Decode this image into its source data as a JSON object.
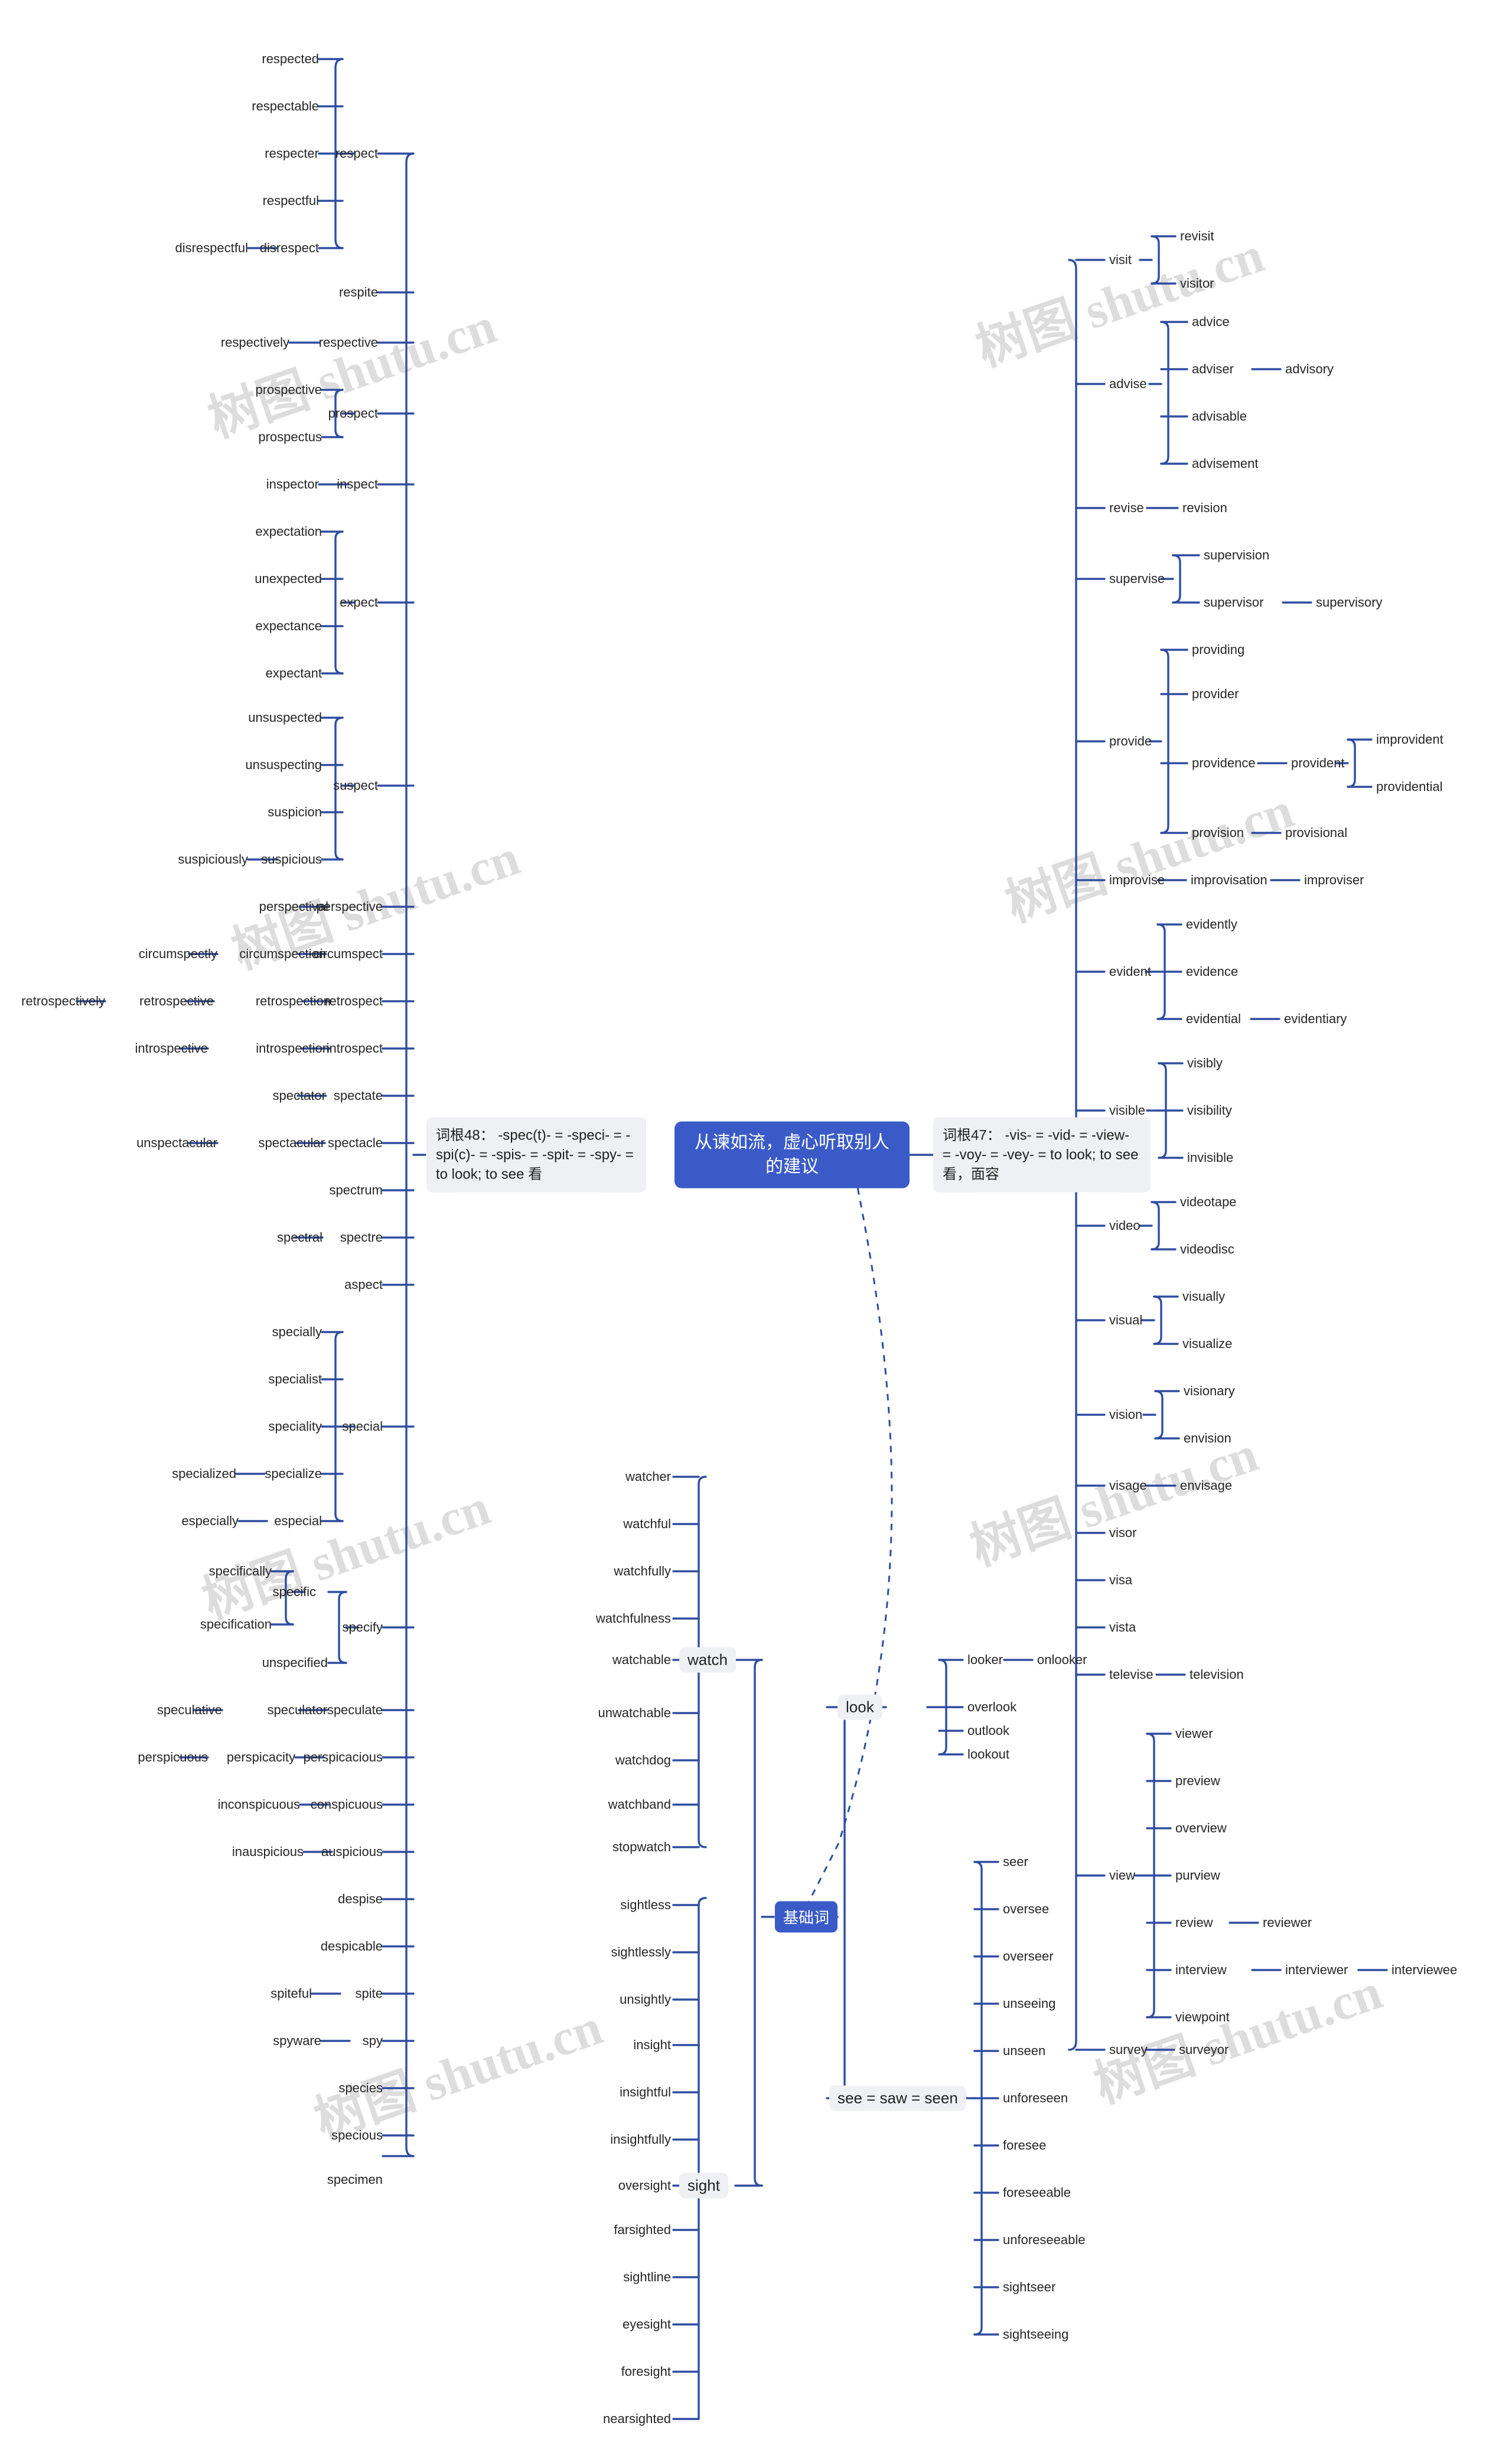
{
  "meta": {
    "root_left_label": "词根48： -spec(t)- = -speci- = -spi(c)- = -spis- = -spit- = -spy- = to look; to see 看",
    "root_center_label": "从谏如流，虚心听取别人的建议",
    "root_right_label": "词根47： -vis- = -vid- = -view- = -voy- = -vey- = to look; to see 看，面容",
    "basic_word_label": "基础词",
    "watermark_text": "树图 shutu.cn",
    "accent_color": "#3a5bc7",
    "link_color": "#2f4da0",
    "chip_bg": "#eef0f4",
    "text_color": "#262626"
  },
  "left_branch": {
    "title": "词根48： -spec(t)- = -speci- = -spi(c)- = -spis- = -spit- = -spy- = to look; to see 看",
    "children": [
      {
        "label": "respect",
        "children": [
          {
            "label": "respected"
          },
          {
            "label": "respectable"
          },
          {
            "label": "respecter"
          },
          {
            "label": "respectful"
          },
          {
            "label": "disrespect",
            "children": [
              {
                "label": "disrespectful"
              }
            ]
          }
        ]
      },
      {
        "label": "respite"
      },
      {
        "label": "respective",
        "children": [
          {
            "label": "respectively"
          }
        ]
      },
      {
        "label": "prospect",
        "children": [
          {
            "label": "prospective"
          },
          {
            "label": "prospectus"
          }
        ]
      },
      {
        "label": "inspect",
        "children": [
          {
            "label": "inspector"
          }
        ]
      },
      {
        "label": "expect",
        "children": [
          {
            "label": "expectation"
          },
          {
            "label": "unexpected"
          },
          {
            "label": "expectance"
          },
          {
            "label": "expectant"
          }
        ]
      },
      {
        "label": "suspect",
        "children": [
          {
            "label": "unsuspected"
          },
          {
            "label": "unsuspecting"
          },
          {
            "label": "suspicion"
          },
          {
            "label": "suspicious",
            "children": [
              {
                "label": "suspiciously"
              }
            ]
          }
        ]
      },
      {
        "label": "perspective",
        "children": [
          {
            "label": "perspectival"
          }
        ]
      },
      {
        "label": "circumspect",
        "children": [
          {
            "label": "circumspection",
            "children": [
              {
                "label": "circumspectly"
              }
            ]
          }
        ]
      },
      {
        "label": "retrospect",
        "children": [
          {
            "label": "retrospection",
            "children": [
              {
                "label": "retrospective",
                "children": [
                  {
                    "label": "retrospectively"
                  }
                ]
              }
            ]
          }
        ]
      },
      {
        "label": "introspect",
        "children": [
          {
            "label": "introspection",
            "children": [
              {
                "label": "introspective"
              }
            ]
          }
        ]
      },
      {
        "label": "spectate",
        "children": [
          {
            "label": "spectator"
          }
        ]
      },
      {
        "label": "spectacle",
        "children": [
          {
            "label": "spectacular",
            "children": [
              {
                "label": "unspectacular"
              }
            ]
          }
        ]
      },
      {
        "label": "spectrum"
      },
      {
        "label": "spectre",
        "children": [
          {
            "label": "spectral"
          }
        ]
      },
      {
        "label": "aspect"
      },
      {
        "label": "special",
        "children": [
          {
            "label": "specially"
          },
          {
            "label": "specialist"
          },
          {
            "label": "speciality"
          },
          {
            "label": "specialize",
            "children": [
              {
                "label": "specialized"
              }
            ]
          },
          {
            "label": "especial",
            "children": [
              {
                "label": "especially"
              }
            ]
          }
        ]
      },
      {
        "label": "specify",
        "children": [
          {
            "label": "specific",
            "children": [
              {
                "label": "specifically"
              },
              {
                "label": "specification"
              }
            ]
          },
          {
            "label": "unspecified"
          }
        ]
      },
      {
        "label": "speculate",
        "children": [
          {
            "label": "speculator",
            "children": [
              {
                "label": "speculative"
              }
            ]
          }
        ]
      },
      {
        "label": "perspicacious",
        "children": [
          {
            "label": "perspicacity",
            "children": [
              {
                "label": "perspicuous"
              }
            ]
          }
        ]
      },
      {
        "label": "conspicuous",
        "children": [
          {
            "label": "inconspicuous"
          }
        ]
      },
      {
        "label": "auspicious",
        "children": [
          {
            "label": "inauspicious"
          }
        ]
      },
      {
        "label": "despise"
      },
      {
        "label": "despicable"
      },
      {
        "label": "spite",
        "children": [
          {
            "label": "spiteful"
          }
        ]
      },
      {
        "label": "spy",
        "children": [
          {
            "label": "spyware"
          }
        ]
      },
      {
        "label": "species"
      },
      {
        "label": "specious"
      },
      {
        "label": "specimen"
      }
    ]
  },
  "right_branch": {
    "title": "词根47： -vis- = -vid- = -view- = -voy- = -vey- = to look; to see 看，面容",
    "children": [
      {
        "label": "visit",
        "children": [
          {
            "label": "revisit"
          },
          {
            "label": "visitor"
          }
        ]
      },
      {
        "label": "advise",
        "children": [
          {
            "label": "advice"
          },
          {
            "label": "adviser",
            "children": [
              {
                "label": "advisory"
              }
            ]
          },
          {
            "label": "advisable"
          },
          {
            "label": "advisement"
          }
        ]
      },
      {
        "label": "revise",
        "children": [
          {
            "label": "revision"
          }
        ]
      },
      {
        "label": "supervise",
        "children": [
          {
            "label": "supervision"
          },
          {
            "label": "supervisor",
            "children": [
              {
                "label": "supervisory"
              }
            ]
          }
        ]
      },
      {
        "label": "provide",
        "children": [
          {
            "label": "providing"
          },
          {
            "label": "provider"
          },
          {
            "label": "providence",
            "children": [
              {
                "label": "provident",
                "children": [
                  {
                    "label": "improvident"
                  },
                  {
                    "label": "providential"
                  }
                ]
              }
            ]
          },
          {
            "label": "provision",
            "children": [
              {
                "label": "provisional"
              }
            ]
          }
        ]
      },
      {
        "label": "improvise",
        "children": [
          {
            "label": "improvisation",
            "children": [
              {
                "label": "improviser"
              }
            ]
          }
        ]
      },
      {
        "label": "evident",
        "children": [
          {
            "label": "evidently"
          },
          {
            "label": "evidence"
          },
          {
            "label": "evidential",
            "children": [
              {
                "label": "evidentiary"
              }
            ]
          }
        ]
      },
      {
        "label": "visible",
        "children": [
          {
            "label": "visibly"
          },
          {
            "label": "visibility"
          },
          {
            "label": "invisible"
          }
        ]
      },
      {
        "label": "video",
        "children": [
          {
            "label": "videotape"
          },
          {
            "label": "videodisc"
          }
        ]
      },
      {
        "label": "visual",
        "children": [
          {
            "label": "visually"
          },
          {
            "label": "visualize"
          }
        ]
      },
      {
        "label": "vision",
        "children": [
          {
            "label": "visionary"
          },
          {
            "label": "envision"
          }
        ]
      },
      {
        "label": "visage",
        "children": [
          {
            "label": "envisage"
          }
        ]
      },
      {
        "label": "visor"
      },
      {
        "label": "visa"
      },
      {
        "label": "vista"
      },
      {
        "label": "televise",
        "children": [
          {
            "label": "television"
          }
        ]
      },
      {
        "label": "view",
        "children": [
          {
            "label": "viewer"
          },
          {
            "label": "preview"
          },
          {
            "label": "overview"
          },
          {
            "label": "purview"
          },
          {
            "label": "review",
            "children": [
              {
                "label": "reviewer"
              }
            ]
          },
          {
            "label": "interview",
            "children": [
              {
                "label": "interviewer",
                "children": [
                  {
                    "label": "interviewee"
                  }
                ]
              }
            ]
          },
          {
            "label": "viewpoint"
          }
        ]
      },
      {
        "label": "survey",
        "children": [
          {
            "label": "surveyor"
          }
        ]
      }
    ]
  },
  "basic_branch": {
    "title": "基础词",
    "children": [
      {
        "label": "watch",
        "children": [
          {
            "label": "watcher"
          },
          {
            "label": "watchful"
          },
          {
            "label": "watchfully"
          },
          {
            "label": "watchfulness"
          },
          {
            "label": "watchable"
          },
          {
            "label": "unwatchable"
          },
          {
            "label": "watchdog"
          },
          {
            "label": "watchband"
          },
          {
            "label": "stopwatch"
          }
        ]
      },
      {
        "label": "look",
        "children": [
          {
            "label": "looker",
            "children": [
              {
                "label": "onlooker"
              }
            ]
          },
          {
            "label": "overlook"
          },
          {
            "label": "outlook"
          },
          {
            "label": "lookout"
          }
        ]
      },
      {
        "label": "sight",
        "children": [
          {
            "label": "sightless"
          },
          {
            "label": "sightlessly"
          },
          {
            "label": "unsightly"
          },
          {
            "label": "insight"
          },
          {
            "label": "insightful"
          },
          {
            "label": "insightfully"
          },
          {
            "label": "oversight"
          },
          {
            "label": "farsighted"
          },
          {
            "label": "sightline"
          },
          {
            "label": "eyesight"
          },
          {
            "label": "foresight"
          },
          {
            "label": "nearsighted"
          }
        ]
      },
      {
        "label": "see = saw = seen",
        "children": [
          {
            "label": "seer"
          },
          {
            "label": "oversee"
          },
          {
            "label": "overseer"
          },
          {
            "label": "unseeing"
          },
          {
            "label": "unseen"
          },
          {
            "label": "unforeseen"
          },
          {
            "label": "foresee"
          },
          {
            "label": "foreseeable"
          },
          {
            "label": "unforeseeable"
          },
          {
            "label": "sightseer"
          },
          {
            "label": "sightseeing"
          }
        ]
      }
    ]
  },
  "nodes": {
    "respected": "respected",
    "respectable": "respectable",
    "respecter": "respecter",
    "respect": "respect",
    "respectful": "respectful",
    "disrespectful": "disrespectful",
    "disrespect": "disrespect",
    "respite": "respite",
    "respectively": "respectively",
    "respective": "respective",
    "prospective": "prospective",
    "prospect": "prospect",
    "prospectus": "prospectus",
    "inspector": "inspector",
    "inspect": "inspect",
    "expectation": "expectation",
    "unexpected": "unexpected",
    "expect": "expect",
    "expectance": "expectance",
    "expectant": "expectant",
    "unsuspected": "unsuspected",
    "unsuspecting": "unsuspecting",
    "suspect": "suspect",
    "suspicion": "suspicion",
    "suspiciously": "suspiciously",
    "suspicious": "suspicious",
    "perspectival": "perspectival",
    "perspective": "perspective",
    "circumspectly": "circumspectly",
    "circumspection": "circumspection",
    "circumspect": "circumspect",
    "retrospectively": "retrospectively",
    "retrospective": "retrospective",
    "retrospection": "retrospection",
    "retrospect": "retrospect",
    "introspective": "introspective",
    "introspection": "introspection",
    "introspect": "introspect",
    "spectator": "spectator",
    "spectate": "spectate",
    "unspectacular": "unspectacular",
    "spectacular": "spectacular",
    "spectacle": "spectacle",
    "spectrum": "spectrum",
    "spectral": "spectral",
    "spectre": "spectre",
    "aspect": "aspect",
    "specially": "specially",
    "specialist": "specialist",
    "speciality": "speciality",
    "special": "special",
    "specialized": "specialized",
    "specialize": "specialize",
    "especially": "especially",
    "especial": "especial",
    "specifically": "specifically",
    "specific": "specific",
    "specification": "specification",
    "specify": "specify",
    "unspecified": "unspecified",
    "speculative": "speculative",
    "speculator": "speculator",
    "speculate": "speculate",
    "perspicuous": "perspicuous",
    "perspicacity": "perspicacity",
    "perspicacious": "perspicacious",
    "inconspicuous": "inconspicuous",
    "conspicuous": "conspicuous",
    "inauspicious": "inauspicious",
    "auspicious": "auspicious",
    "despise": "despise",
    "despicable": "despicable",
    "spiteful": "spiteful",
    "spite": "spite",
    "spyware": "spyware",
    "spy": "spy",
    "species": "species",
    "specious": "specious",
    "specimen": "specimen",
    "visit": "visit",
    "revisit": "revisit",
    "visitor": "visitor",
    "advise": "advise",
    "advice": "advice",
    "adviser": "adviser",
    "advisory": "advisory",
    "advisable": "advisable",
    "advisement": "advisement",
    "revise": "revise",
    "revision": "revision",
    "supervise": "supervise",
    "supervision": "supervision",
    "supervisor": "supervisor",
    "supervisory": "supervisory",
    "provide": "provide",
    "providing": "providing",
    "provider": "provider",
    "providence": "providence",
    "provident": "provident",
    "improvident": "improvident",
    "providential": "providential",
    "provision": "provision",
    "provisional": "provisional",
    "improvise": "improvise",
    "improvisation": "improvisation",
    "improviser": "improviser",
    "evident": "evident",
    "evidently": "evidently",
    "evidence": "evidence",
    "evidential": "evidential",
    "evidentiary": "evidentiary",
    "visible": "visible",
    "visibly": "visibly",
    "visibility": "visibility",
    "invisible": "invisible",
    "video": "video",
    "videotape": "videotape",
    "videodisc": "videodisc",
    "visual": "visual",
    "visually": "visually",
    "visualize": "visualize",
    "vision": "vision",
    "visionary": "visionary",
    "envision": "envision",
    "visage": "visage",
    "envisage": "envisage",
    "visor": "visor",
    "visa": "visa",
    "vista": "vista",
    "televise": "televise",
    "television": "television",
    "view": "view",
    "viewer": "viewer",
    "preview": "preview",
    "overview": "overview",
    "purview": "purview",
    "review": "review",
    "reviewer": "reviewer",
    "interview": "interview",
    "interviewer": "interviewer",
    "interviewee": "interviewee",
    "viewpoint": "viewpoint",
    "survey": "survey",
    "surveyor": "surveyor",
    "watcher": "watcher",
    "watchful": "watchful",
    "watchfully": "watchfully",
    "watchfulness": "watchfulness",
    "watchable": "watchable",
    "watch": "watch",
    "unwatchable": "unwatchable",
    "watchdog": "watchdog",
    "watchband": "watchband",
    "stopwatch": "stopwatch",
    "looker": "looker",
    "onlooker": "onlooker",
    "overlook": "overlook",
    "look": "look",
    "outlook": "outlook",
    "lookout": "lookout",
    "sightless": "sightless",
    "sightlessly": "sightlessly",
    "unsightly": "unsightly",
    "insight": "insight",
    "insightful": "insightful",
    "insightfully": "insightfully",
    "oversight": "oversight",
    "sight": "sight",
    "farsighted": "farsighted",
    "sightline": "sightline",
    "eyesight": "eyesight",
    "foresight": "foresight",
    "nearsighted": "nearsighted",
    "seer": "seer",
    "oversee": "oversee",
    "overseer": "overseer",
    "unseeing": "unseeing",
    "unseen": "unseen",
    "unforeseen": "unforeseen",
    "see_saw_seen": "see = saw = seen",
    "foresee": "foresee",
    "foreseeable": "foreseeable",
    "unforeseeable": "unforeseeable",
    "sightseer": "sightseer",
    "sightseeing": "sightseeing"
  }
}
